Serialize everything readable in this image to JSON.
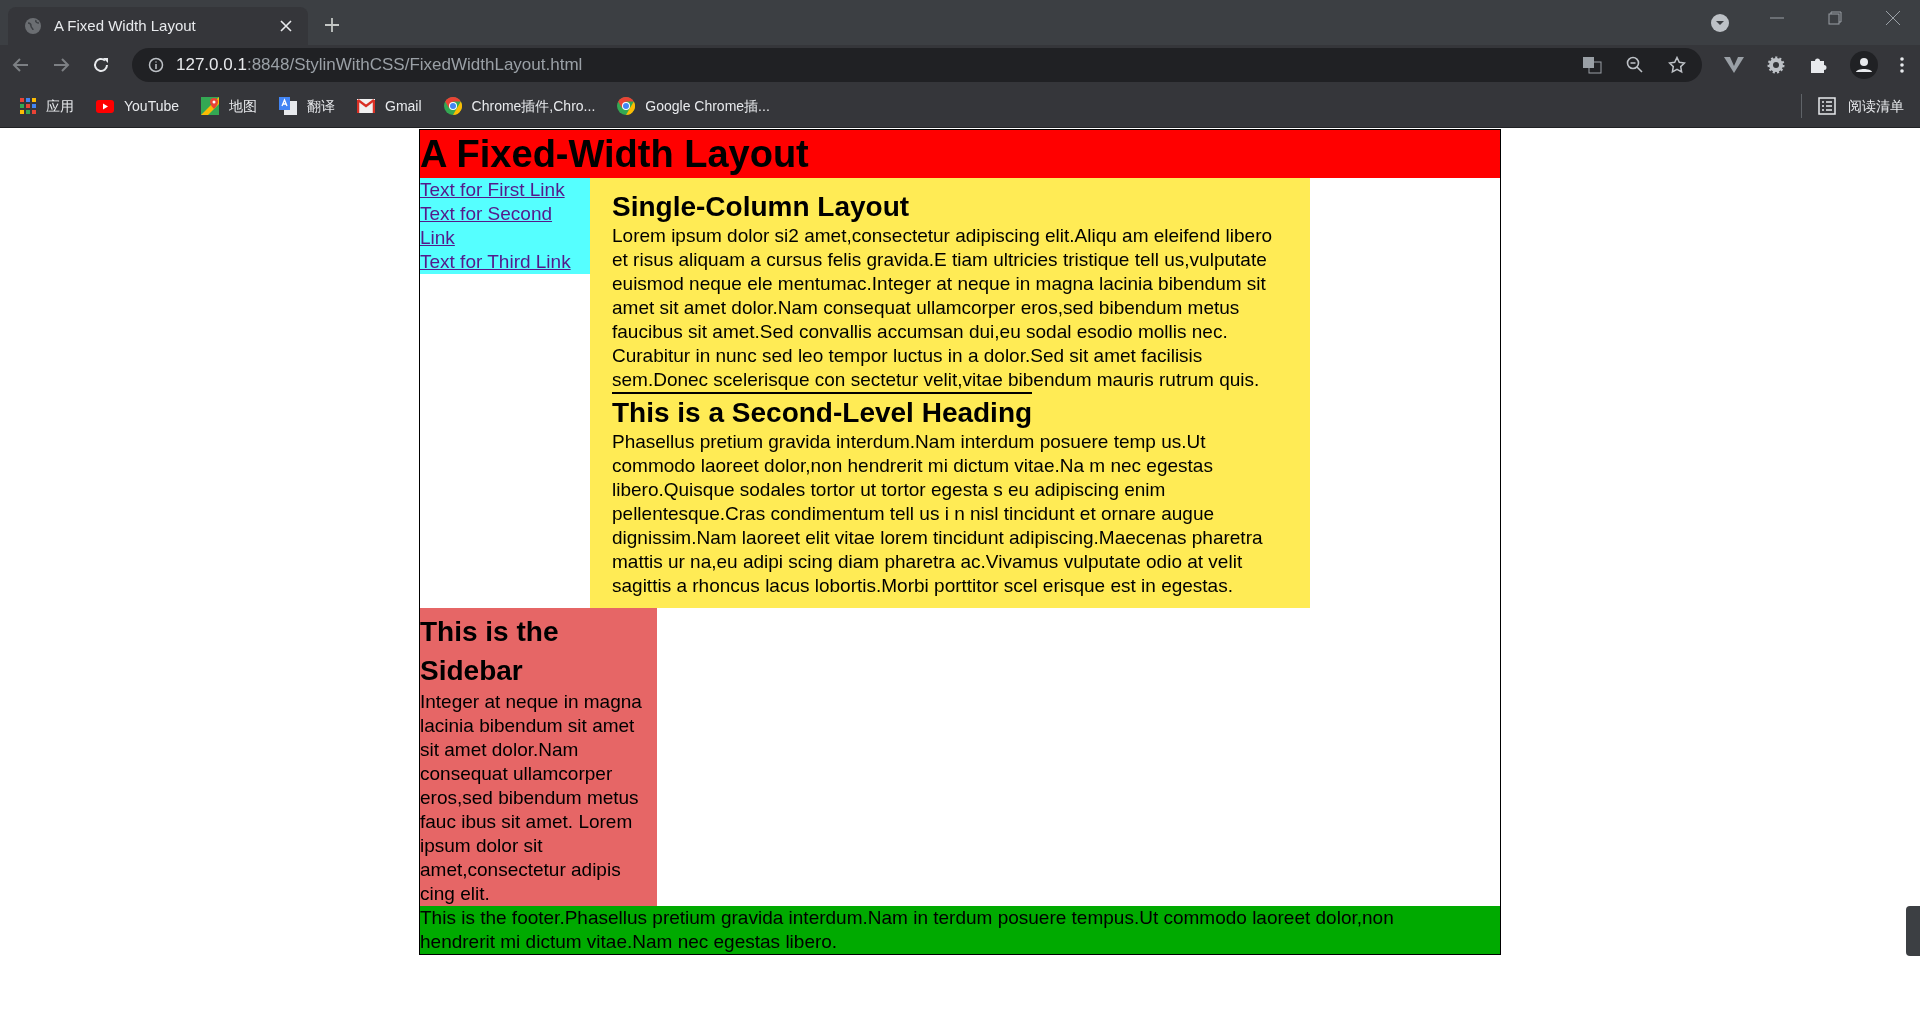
{
  "browser": {
    "tab": {
      "title": "A Fixed Width Layout"
    },
    "url": {
      "host": "127.0.0.1",
      "rest": ":8848/StylinWithCSS/FixedWidthLayout.html"
    },
    "bookmarks": [
      {
        "kind": "apps",
        "label": "应用"
      },
      {
        "kind": "youtube",
        "label": "YouTube"
      },
      {
        "kind": "maps",
        "label": "地图"
      },
      {
        "kind": "translate",
        "label": "翻译"
      },
      {
        "kind": "gmail",
        "label": "Gmail"
      },
      {
        "kind": "chrome",
        "label": "Chrome插件,Chro..."
      },
      {
        "kind": "chrome",
        "label": "Google Chrome插..."
      }
    ],
    "reading_list": "阅读清单"
  },
  "page": {
    "header": "A Fixed-Width Layout",
    "nav_links": [
      "Text for First Link",
      "Text for Second Link",
      "Text for Third Link"
    ],
    "content": [
      {
        "kind": "heading",
        "text": "Single-Column Layout"
      },
      {
        "kind": "paragraph",
        "text": "Lorem ipsum dolor si2 amet,consectetur adipiscing elit.Aliqu am eleifend libero et risus aliquam a cursus felis gravida.E tiam ultricies tristique tell us,vulputate euismod neque ele mentumac.Integer at neque in magna lacinia bibendum sit amet sit amet dolor.Nam consequat ullamcorper eros,sed bibendum metus faucibus sit amet.Sed convallis accumsan dui,eu sodal esodio mollis nec. Curabitur in nunc sed leo tempor luctus in a dolor.Sed sit amet facilisis sem.Donec scelerisque con sectetur velit,vitae bibendum mauris rutrum quis."
      },
      {
        "kind": "rule"
      },
      {
        "kind": "heading",
        "text": "This is a Second-Level Heading"
      },
      {
        "kind": "paragraph",
        "text": "Phasellus pretium gravida interdum.Nam interdum posuere temp us.Ut commodo laoreet dolor,non hendrerit mi dictum vitae.Na m nec egestas libero.Quisque sodales tortor ut tortor egesta s eu adipiscing enim pellentesque.Cras condimentum tell us i n nisl tincidunt et ornare augue dignissim.Nam laoreet elit vitae lorem tincidunt adipiscing.Maecenas pharetra mattis ur na,eu adipi scing diam pharetra ac.Vivamus vulputate odio at velit sagittis a rhoncus lacus lobortis.Morbi porttitor scel erisque est in egestas."
      }
    ],
    "sidebar": {
      "heading": "This is the Sidebar",
      "text": "Integer at neque in magna lacinia bibendum sit amet sit amet dolor.Nam consequat ullamcorper eros,sed bibendum metus fauc ibus sit amet. Lorem ipsum dolor sit amet,consectetur adipis cing elit."
    },
    "footer": "This is the footer.Phasellus pretium gravida interdum.Nam in terdum posuere tempus.Ut commodo laoreet dolor,non hendrerit mi dictum vitae.Nam nec egestas libero."
  }
}
